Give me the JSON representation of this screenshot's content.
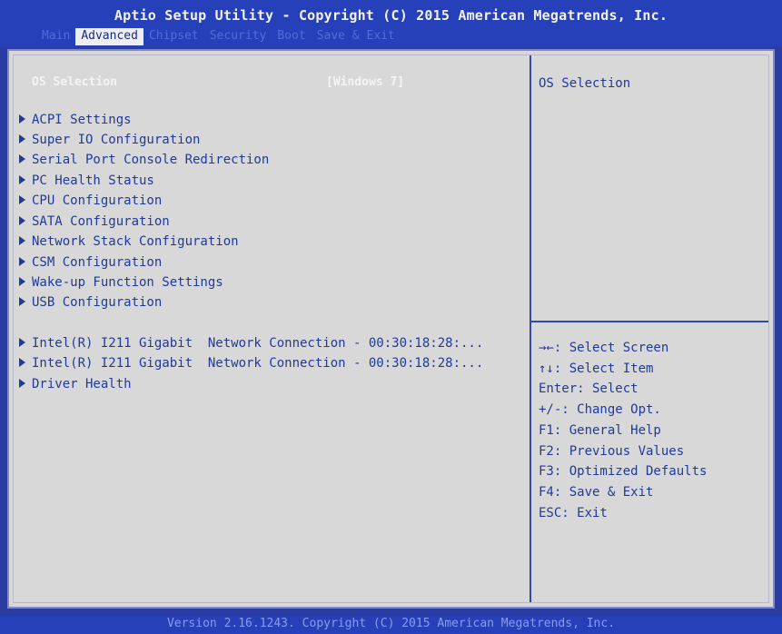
{
  "header": {
    "title": "Aptio Setup Utility - Copyright (C) 2015 American Megatrends, Inc.",
    "tabs": [
      "Main",
      "Advanced",
      "Chipset",
      "Security",
      "Boot",
      "Save & Exit"
    ],
    "active_tab": "Advanced"
  },
  "os_selection": {
    "label": "OS Selection",
    "value": "[Windows 7]"
  },
  "menu_items": [
    "ACPI Settings",
    "Super IO Configuration",
    "Serial Port Console Redirection",
    "PC Health Status",
    "CPU Configuration",
    "SATA Configuration",
    "Network Stack Configuration",
    "CSM Configuration",
    "Wake-up Function Settings",
    "USB Configuration"
  ],
  "device_items": [
    "Intel(R) I211 Gigabit  Network Connection - 00:30:18:28:...",
    "Intel(R) I211 Gigabit  Network Connection - 00:30:18:28:...",
    "Driver Health"
  ],
  "help": {
    "title": "OS Selection"
  },
  "keys": [
    "→←: Select Screen",
    "↑↓: Select Item",
    "Enter: Select",
    "+/-: Change Opt.",
    "F1: General Help",
    "F2: Previous Values",
    "F3: Optimized Defaults",
    "F4: Save & Exit",
    "ESC: Exit"
  ],
  "footer": {
    "text": "Version 2.16.1243. Copyright (C) 2015 American Megatrends, Inc."
  },
  "colors": {
    "background_blue": "#2a3ba1",
    "panel_gray": "#d8d8d8",
    "item_blue": "#1f3a9a",
    "highlight_white": "#f4f4f4"
  }
}
